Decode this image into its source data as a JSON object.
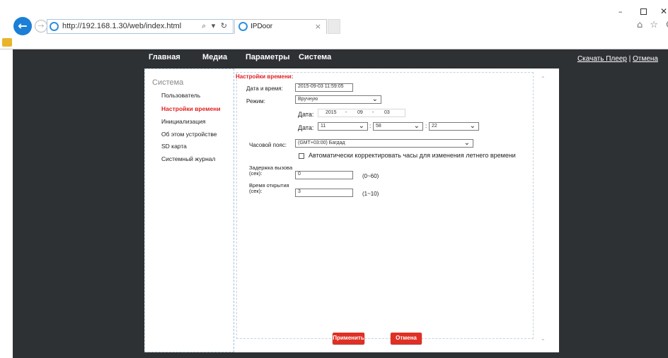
{
  "browser": {
    "url": "http://192.168.1.30/web/index.html",
    "address_icons": "⌕ ▾ ↻",
    "tab_title": "IPDoor",
    "tab_close": "×",
    "back_icon": "back-arrow-icon",
    "window_min": "–",
    "window_close": "✕",
    "tool_icons": "⌂ ☆ ⚙ ☺"
  },
  "nav": {
    "items": [
      "Главная",
      "Медиа",
      "Параметры",
      "Система"
    ],
    "download_player": "Скачать Плеер",
    "separator": " | ",
    "logout": "Отмена"
  },
  "sidebar": {
    "title": "Система",
    "items": [
      {
        "label": "Пользователь",
        "active": false
      },
      {
        "label": "Настройки времени",
        "active": true
      },
      {
        "label": "Инициализация",
        "active": false
      },
      {
        "label": "Об этом устройстве",
        "active": false
      },
      {
        "label": "SD карта",
        "active": false
      },
      {
        "label": "Системный журнал",
        "active": false
      }
    ]
  },
  "form": {
    "section_title": "Настройки времени:",
    "datetime_label": "Дата и время:",
    "datetime_value": "2015-09-03 11:59:05",
    "mode_label": "Режим:",
    "mode_value": "Вручную",
    "date_label": "Дата:",
    "date_year": "2015",
    "date_month": "09",
    "date_day": "03",
    "date_sep": "-",
    "time_label": "Дата:",
    "time_hour": "11",
    "time_minute": "58",
    "time_second": "22",
    "time_sep": ":",
    "timezone_label": "Часовой пояс:",
    "timezone_value": "(GMT+03:00) Багдад",
    "dst_label": "Автоматически корректировать часы для изменения летнего времени",
    "call_delay_label": "Задержка вызова (сек):",
    "call_delay_value": "0",
    "call_delay_range": "(0~60)",
    "open_time_label": "Время открытия (сек):",
    "open_time_value": "3",
    "open_time_range": "(1~10)"
  },
  "buttons": {
    "apply": "Применить",
    "cancel": "Отмена"
  },
  "colors": {
    "accent_red": "#e02020",
    "button_red": "#e02f24",
    "page_background": "#2e3133"
  }
}
